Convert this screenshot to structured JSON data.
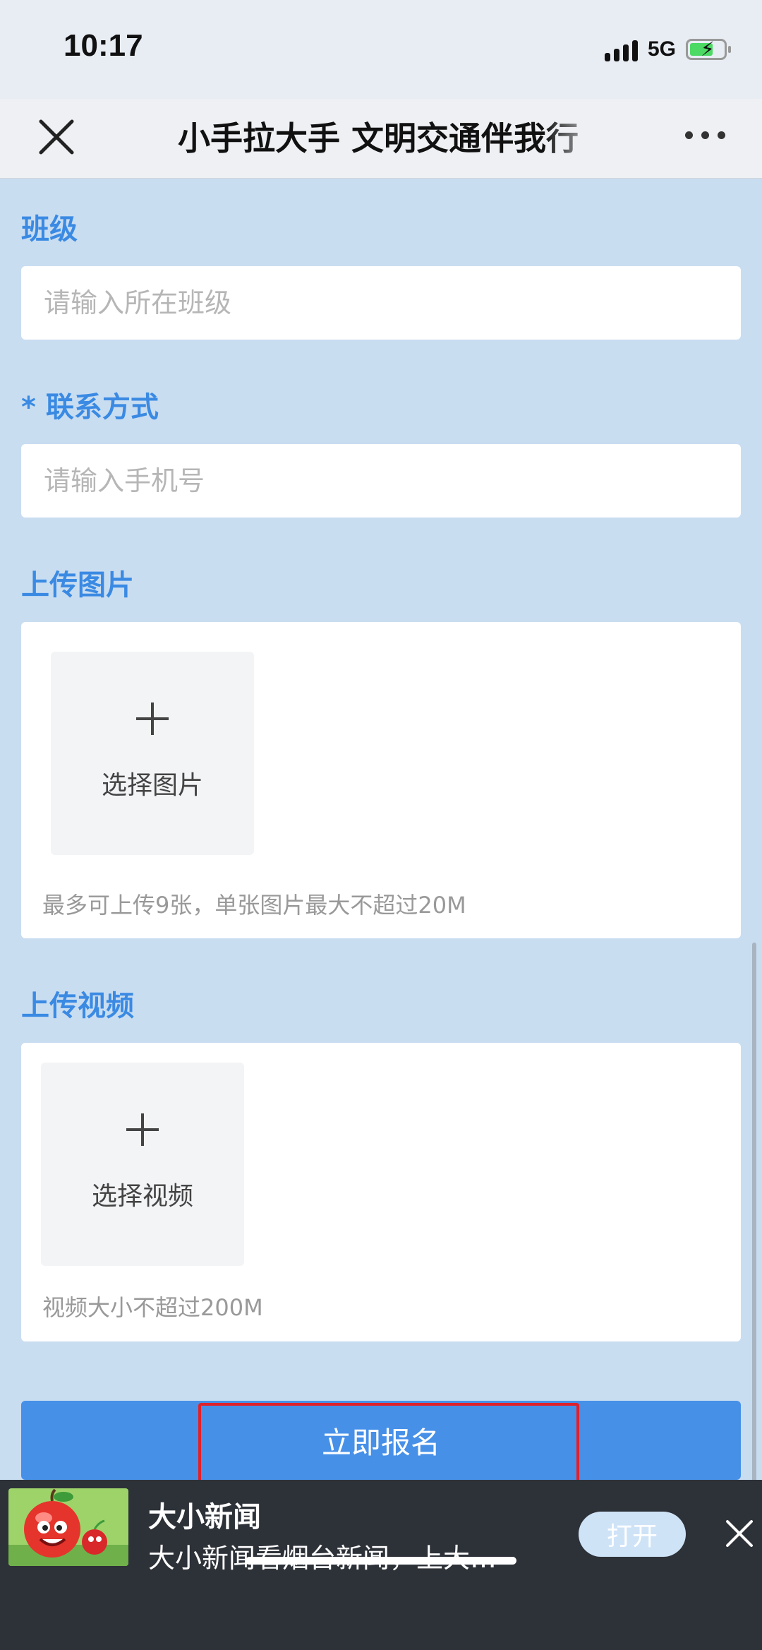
{
  "status_bar": {
    "time": "10:17",
    "network": "5G"
  },
  "nav": {
    "title": "小手拉大手 文明交通伴我行"
  },
  "form": {
    "class_label": "班级",
    "class_placeholder": "请输入所在班级",
    "contact_label": "* 联系方式",
    "contact_placeholder": "请输入手机号",
    "image_label": "上传图片",
    "image_picker_label": "选择图片",
    "image_hint": "最多可上传9张，单张图片最大不超过20M",
    "video_label": "上传视频",
    "video_picker_label": "选择视频",
    "video_hint": "视频大小不超过200M",
    "submit_label": "立即报名"
  },
  "banner": {
    "app_name": "大小新闻",
    "description": "大小新闻看烟台新闻，上大…",
    "open_label": "打开"
  },
  "colors": {
    "accent": "#3a8ae3",
    "button": "#4690e8",
    "page_bg": "#c9ddf1",
    "highlight": "#e0202a"
  }
}
